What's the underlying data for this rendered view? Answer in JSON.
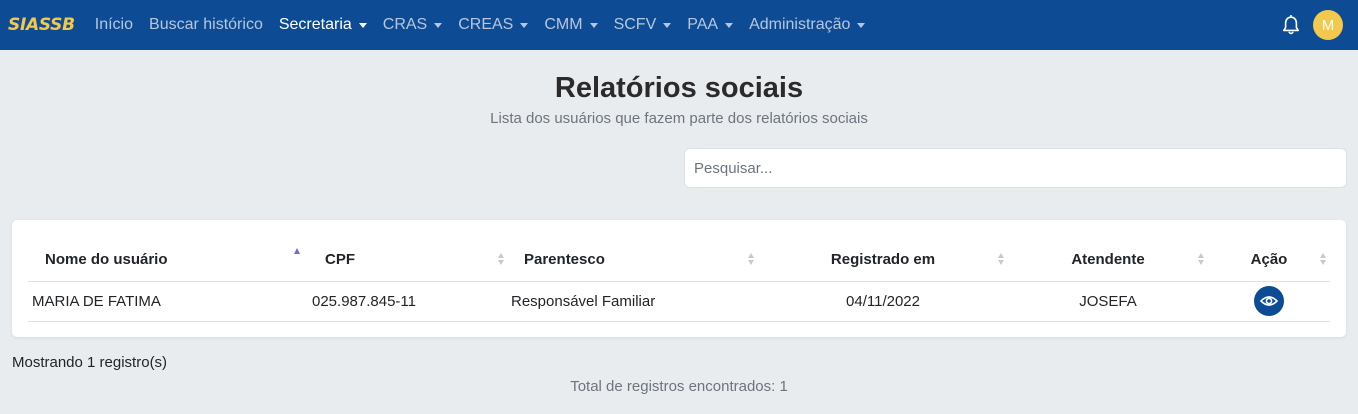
{
  "navbar": {
    "brand": "SIASSB",
    "links": [
      {
        "label": "Início",
        "dropdown": false,
        "active": false
      },
      {
        "label": "Buscar histórico",
        "dropdown": false,
        "active": false
      },
      {
        "label": "Secretaria",
        "dropdown": true,
        "active": true
      },
      {
        "label": "CRAS",
        "dropdown": true,
        "active": false
      },
      {
        "label": "CREAS",
        "dropdown": true,
        "active": false
      },
      {
        "label": "CMM",
        "dropdown": true,
        "active": false
      },
      {
        "label": "SCFV",
        "dropdown": true,
        "active": false
      },
      {
        "label": "PAA",
        "dropdown": true,
        "active": false
      },
      {
        "label": "Administração",
        "dropdown": true,
        "active": false
      }
    ],
    "notification_icon": "bell-icon",
    "avatar_initial": "M"
  },
  "page": {
    "title": "Relatórios sociais",
    "subtitle": "Lista dos usuários que fazem parte dos relatórios sociais"
  },
  "search": {
    "placeholder": "Pesquisar...",
    "value": ""
  },
  "table": {
    "columns": [
      "Nome do usuário",
      "CPF",
      "Parentesco",
      "Registrado em",
      "Atendente",
      "Ação"
    ],
    "rows": [
      {
        "nome": "MARIA DE FATIMA",
        "cpf": "025.987.845-11",
        "parentesco": "Responsável Familiar",
        "registrado": "04/11/2022",
        "atendente": "JOSEFA",
        "acao_icon": "eye-icon"
      }
    ]
  },
  "footer": {
    "showing": "Mostrando 1 registro(s)",
    "total": "Total de registros encontrados: 1"
  },
  "colors": {
    "navbar": "#0d4c94",
    "brand": "#f2c94c",
    "avatar": "#f2c94c",
    "action_button": "#0d4c94",
    "background": "#e9ecef"
  }
}
